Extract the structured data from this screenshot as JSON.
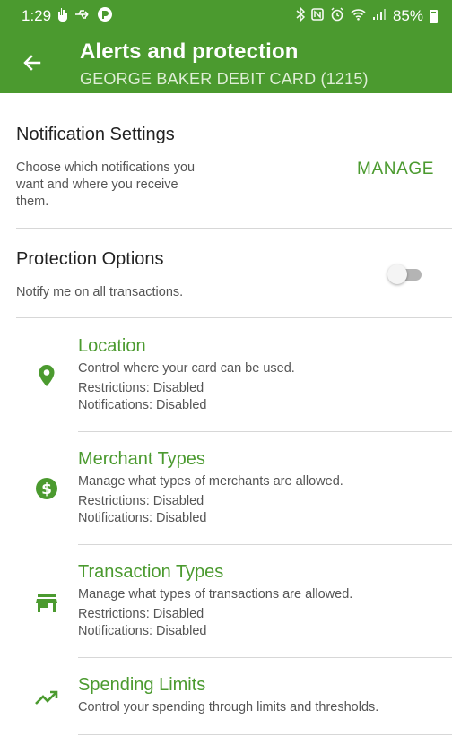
{
  "status_bar": {
    "time": "1:29",
    "battery": "85%",
    "icons": [
      "hand-icon",
      "usb-icon",
      "app-icon",
      "bluetooth-icon",
      "nfc-icon",
      "alarm-icon",
      "wifi-icon",
      "signal-icon",
      "battery-icon"
    ]
  },
  "header": {
    "title": "Alerts and protection",
    "subtitle": "GEORGE BAKER DEBIT CARD (1215)"
  },
  "notification_settings": {
    "heading": "Notification Settings",
    "description_lines": [
      "Choose which notifications you",
      "want and where you receive",
      "them."
    ],
    "action": "MANAGE"
  },
  "protection_options": {
    "heading": "Protection Options",
    "description": "Notify me on all transactions.",
    "toggle_on": false
  },
  "features": [
    {
      "icon": "location-pin-icon",
      "title": "Location",
      "description": "Control where your card can be used.",
      "restrictions": "Restrictions: Disabled",
      "notifications": "Notifications: Disabled"
    },
    {
      "icon": "dollar-circle-icon",
      "title": "Merchant Types",
      "description": "Manage what types of merchants are allowed.",
      "restrictions": "Restrictions: Disabled",
      "notifications": "Notifications: Disabled"
    },
    {
      "icon": "store-icon",
      "title": "Transaction Types",
      "description": "Manage what types of transactions are allowed.",
      "restrictions": "Restrictions: Disabled",
      "notifications": "Notifications: Disabled"
    },
    {
      "icon": "trending-up-icon",
      "title": "Spending Limits",
      "description": "Control your spending through limits and thresholds."
    }
  ],
  "colors": {
    "brand_green": "#4b9a2f",
    "subtitle_text": "#dfeed6",
    "body_text": "#222222",
    "secondary_text": "#555555",
    "divider": "#d7d7d7"
  }
}
